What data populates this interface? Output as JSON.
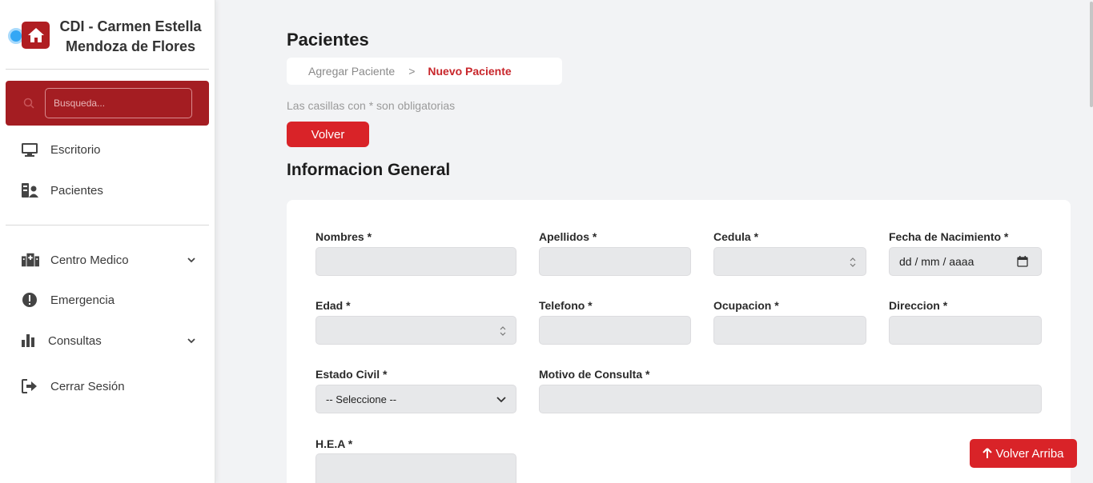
{
  "brand": {
    "name": "CDI - Carmen Estella Mendoza de Flores",
    "icon": "home-icon",
    "color": "#b01e22"
  },
  "search": {
    "placeholder": "Busqueda..."
  },
  "nav": {
    "escritorio": "Escritorio",
    "pacientes": "Pacientes",
    "centro_medico": "Centro Medico",
    "emergencia": "Emergencia",
    "consultas": "Consultas",
    "cerrar_sesion": "Cerrar Sesión"
  },
  "page": {
    "title": "Pacientes",
    "breadcrumb": [
      "Agregar Paciente",
      ">",
      "Nuevo Paciente"
    ],
    "required_note": "Las casillas con * son obligatorias",
    "back_button": "Volver",
    "section_title": "Informacion General"
  },
  "form": {
    "nombres": "Nombres *",
    "apellidos": "Apellidos *",
    "cedula": "Cedula *",
    "fecha_nacimiento": "Fecha de Nacimiento *",
    "fecha_placeholder": "dd / mm / aaaa",
    "edad": "Edad *",
    "telefono": "Telefono *",
    "ocupacion": "Ocupacion *",
    "direccion": "Direccion *",
    "estado_civil": "Estado Civil *",
    "estado_civil_value": "-- Seleccione --",
    "motivo_consulta": "Motivo de Consulta *",
    "hea": "H.E.A *"
  },
  "scroll_top_button": "Volver Arriba",
  "colors": {
    "accent": "#d92328",
    "sidebar_search": "#a41d22",
    "breadcrumb_active": "#c8262b"
  }
}
